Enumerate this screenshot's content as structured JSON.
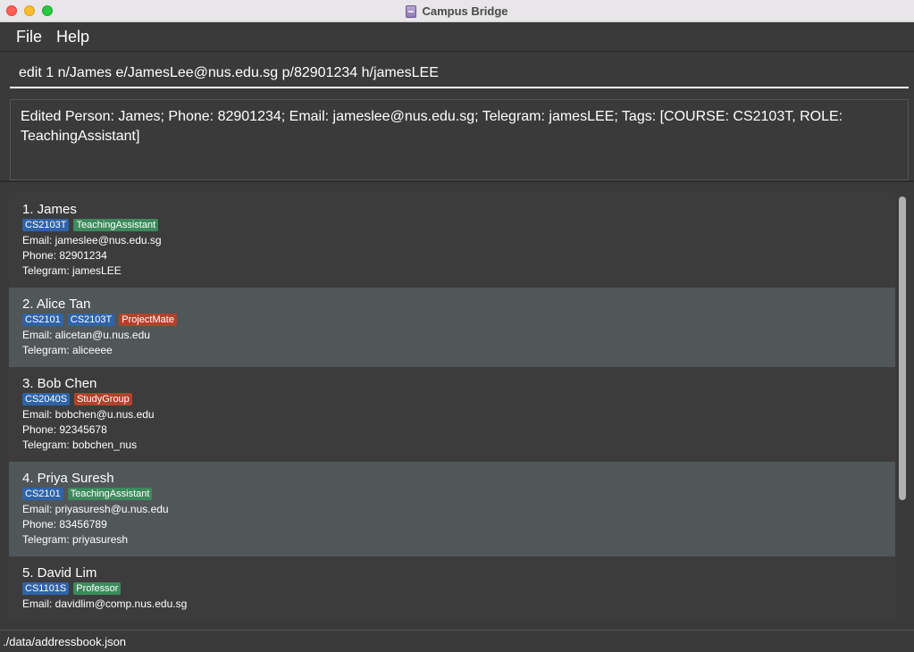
{
  "window": {
    "title": "Campus Bridge"
  },
  "menu": {
    "file": "File",
    "help": "Help"
  },
  "command": {
    "value": "edit 1 n/James e/JamesLee@nus.edu.sg p/82901234 h/jamesLEE"
  },
  "result": {
    "text": "Edited Person: James; Phone: 82901234; Email: jameslee@nus.edu.sg; Telegram: jamesLEE; Tags: [COURSE: CS2103T, ROLE: TeachingAssistant]"
  },
  "colors": {
    "course_tag": "#2e63a8",
    "role_tag": "#3d8a5c",
    "other_tag": "#b0432a"
  },
  "persons": [
    {
      "name": "1. James",
      "tags": [
        {
          "label": "CS2103T",
          "kind": "course"
        },
        {
          "label": "TeachingAssistant",
          "kind": "role"
        }
      ],
      "email": "Email: jameslee@nus.edu.sg",
      "phone": "Phone: 82901234",
      "telegram": "Telegram: jamesLEE"
    },
    {
      "name": "2. Alice Tan",
      "tags": [
        {
          "label": "CS2101",
          "kind": "course"
        },
        {
          "label": "CS2103T",
          "kind": "course"
        },
        {
          "label": "ProjectMate",
          "kind": "other"
        }
      ],
      "email": "Email: alicetan@u.nus.edu",
      "telegram": "Telegram: aliceeee"
    },
    {
      "name": "3. Bob Chen",
      "tags": [
        {
          "label": "CS2040S",
          "kind": "course"
        },
        {
          "label": "StudyGroup",
          "kind": "other"
        }
      ],
      "email": "Email: bobchen@u.nus.edu",
      "phone": "Phone: 92345678",
      "telegram": "Telegram: bobchen_nus"
    },
    {
      "name": "4. Priya Suresh",
      "tags": [
        {
          "label": "CS2101",
          "kind": "course"
        },
        {
          "label": "TeachingAssistant",
          "kind": "role"
        }
      ],
      "email": "Email: priyasuresh@u.nus.edu",
      "phone": "Phone: 83456789",
      "telegram": "Telegram: priyasuresh"
    },
    {
      "name": "5. David Lim",
      "tags": [
        {
          "label": "CS1101S",
          "kind": "course"
        },
        {
          "label": "Professor",
          "kind": "role"
        }
      ],
      "email": "Email: davidlim@comp.nus.edu.sg"
    }
  ],
  "status": {
    "path": "./data/addressbook.json"
  }
}
